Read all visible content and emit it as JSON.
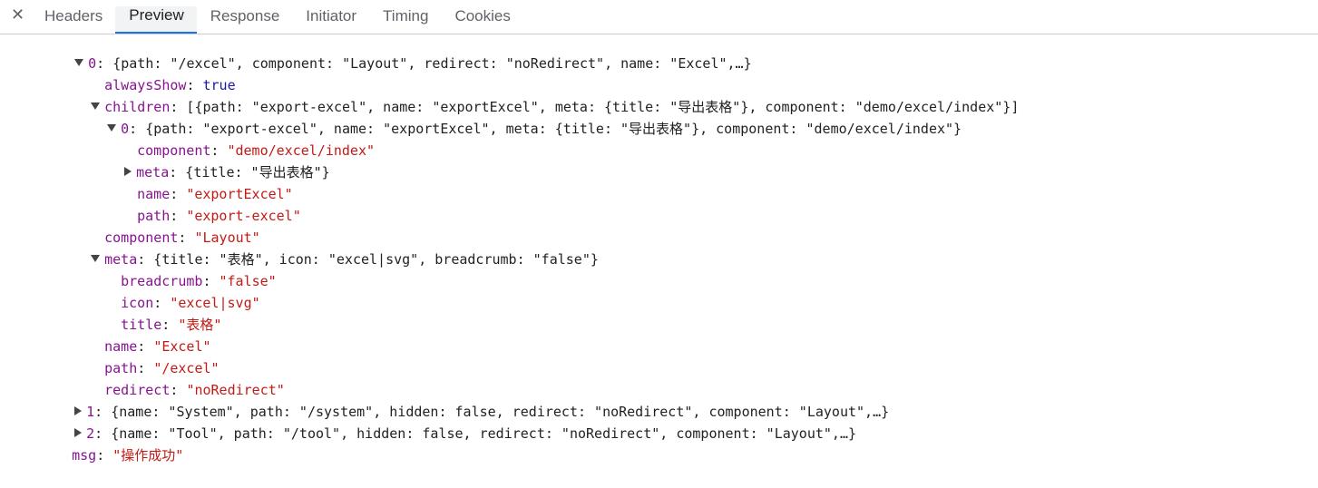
{
  "tabs": {
    "close": "✕",
    "items": [
      "Headers",
      "Preview",
      "Response",
      "Initiator",
      "Timing",
      "Cookies"
    ]
  },
  "tree": {
    "r0_key": "0",
    "r0_summary": ": {path: \"/excel\", component: \"Layout\", redirect: \"noRedirect\", name: \"Excel\",…}",
    "alwaysShow_key": "alwaysShow",
    "alwaysShow_val": "true",
    "children_key": "children",
    "children_summary": ": [{path: \"export-excel\", name: \"exportExcel\", meta: {title: \"导出表格\"}, component: \"demo/excel/index\"}]",
    "c0_key": "0",
    "c0_summary": ": {path: \"export-excel\", name: \"exportExcel\", meta: {title: \"导出表格\"}, component: \"demo/excel/index\"}",
    "c0_component_key": "component",
    "c0_component_val": "\"demo/excel/index\"",
    "c0_meta_key": "meta",
    "c0_meta_summary": ": {title: \"导出表格\"}",
    "c0_name_key": "name",
    "c0_name_val": "\"exportExcel\"",
    "c0_path_key": "path",
    "c0_path_val": "\"export-excel\"",
    "component_key": "component",
    "component_val": "\"Layout\"",
    "meta_key": "meta",
    "meta_summary": ": {title: \"表格\", icon: \"excel|svg\", breadcrumb: \"false\"}",
    "breadcrumb_key": "breadcrumb",
    "breadcrumb_val": "\"false\"",
    "icon_key": "icon",
    "icon_val": "\"excel|svg\"",
    "title_key": "title",
    "title_val": "\"表格\"",
    "name_key": "name",
    "name_val": "\"Excel\"",
    "path_key": "path",
    "path_val": "\"/excel\"",
    "redirect_key": "redirect",
    "redirect_val": "\"noRedirect\"",
    "r1_key": "1",
    "r1_summary": ": {name: \"System\", path: \"/system\", hidden: false, redirect: \"noRedirect\", component: \"Layout\",…}",
    "r2_key": "2",
    "r2_summary": ": {name: \"Tool\", path: \"/tool\", hidden: false, redirect: \"noRedirect\", component: \"Layout\",…}",
    "msg_key": "msg",
    "msg_val": "\"操作成功\""
  },
  "colors": {
    "key": "#881391",
    "string": "#c41a16",
    "boolean": "#1a1aa6",
    "active_tab": "#1a73e8"
  }
}
